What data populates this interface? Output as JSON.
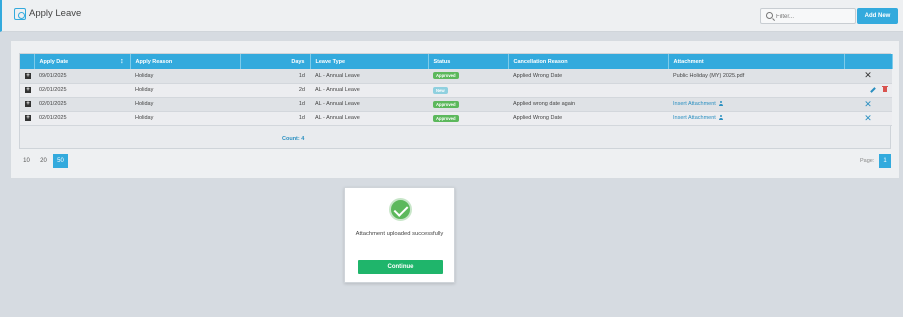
{
  "header": {
    "title": "Apply Leave",
    "filter_placeholder": "Filter...",
    "add_new_label": "Add New"
  },
  "table": {
    "columns": [
      "Apply Date",
      "Apply Reason",
      "Days",
      "Leave Type",
      "Status",
      "Cancellation Reason",
      "Attachment"
    ],
    "rows": [
      {
        "apply_date": "09/01/2025",
        "apply_reason": "Holiday",
        "days": "1d",
        "leave_type": "AL - Annual Leave",
        "status": "Approved",
        "cancellation_reason": "Applied Wrong Date",
        "attachment": "Public Holiday (MY) 2025.pdf"
      },
      {
        "apply_date": "02/01/2025",
        "apply_reason": "Holiday",
        "days": "2d",
        "leave_type": "AL - Annual Leave",
        "status": "New",
        "cancellation_reason": "",
        "attachment": ""
      },
      {
        "apply_date": "02/01/2025",
        "apply_reason": "Holiday",
        "days": "1d",
        "leave_type": "AL - Annual Leave",
        "status": "Approved",
        "cancellation_reason": "Applied wrong date again",
        "attachment": "Insert Attachment"
      },
      {
        "apply_date": "02/01/2025",
        "apply_reason": "Holiday",
        "days": "1d",
        "leave_type": "AL - Annual Leave",
        "status": "Approved",
        "cancellation_reason": "Applied Wrong Date",
        "attachment": "Insert Attachment"
      }
    ],
    "count_label": "Count: 4"
  },
  "pager": {
    "sizes": [
      "10",
      "20",
      "50"
    ],
    "active_size": "50",
    "page_label": "Page:",
    "current_page": "1"
  },
  "dialog": {
    "message": "Attachment uploaded successfully",
    "continue_label": "Continue"
  },
  "colors": {
    "accent": "#33aadd",
    "approved": "#5cb85c",
    "new": "#8fd0df",
    "continue": "#1fb56b"
  }
}
